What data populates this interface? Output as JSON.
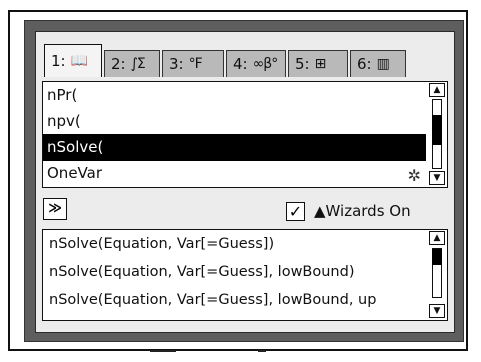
{
  "tabs": [
    {
      "number": "1:",
      "icon": "📖",
      "icon_name": "catalog-book-icon"
    },
    {
      "number": "2:",
      "icon": "∫Σ",
      "icon_name": "math-templates-icon"
    },
    {
      "number": "3:",
      "icon": "°F",
      "icon_name": "units-icon"
    },
    {
      "number": "4:",
      "icon": "∞β°",
      "icon_name": "symbols-icon"
    },
    {
      "number": "5:",
      "icon": "⊞",
      "icon_name": "templates-icon"
    },
    {
      "number": "6:",
      "icon": "▥",
      "icon_name": "libraries-icon"
    }
  ],
  "catalog": {
    "items": [
      "nPr(",
      "npv(",
      "nSolve(",
      "OneVar"
    ],
    "selected_index": 2,
    "scroll_fraction": 0.4
  },
  "wizards": {
    "label": "▲Wizards On",
    "checked": true,
    "check_glyph": "✓"
  },
  "expand_glyph": "≫",
  "help_lines": [
    "nSolve(Equation, Var[=Guess])",
    "nSolve(Equation, Var[=Guess], lowBound)",
    "nSolve(Equation, Var[=Guess], lowBound, up"
  ]
}
